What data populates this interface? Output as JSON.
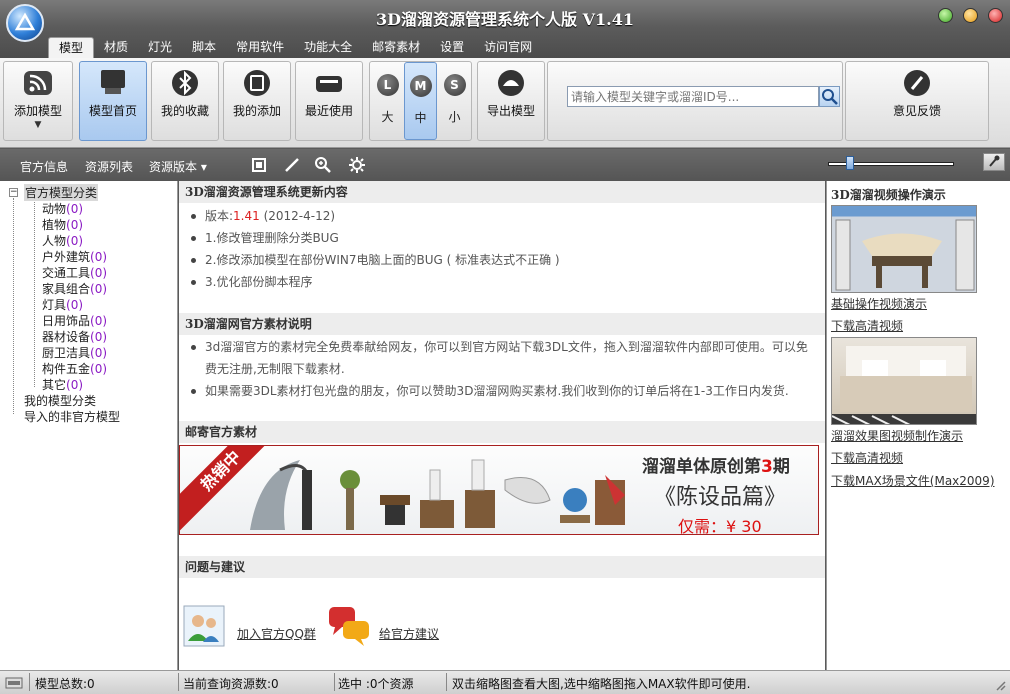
{
  "app": {
    "title": "3D溜溜资源管理系统个人版  V1.41"
  },
  "tabs": [
    "模型",
    "材质",
    "灯光",
    "脚本",
    "常用软件",
    "功能大全",
    "邮寄素材",
    "设置",
    "访问官网"
  ],
  "active_tab": "模型",
  "ribbon": {
    "add_model": "添加模型",
    "model_home": "模型首页",
    "my_favorites": "我的收藏",
    "my_added": "我的添加",
    "recent": "最近使用",
    "size_large": "大",
    "size_medium": "中",
    "size_small": "小",
    "size_large_letter": "L",
    "size_medium_letter": "M",
    "size_small_letter": "S",
    "export_model": "导出模型",
    "search_placeholder": "请输入模型关键字或溜溜ID号...",
    "feedback": "意见反馈"
  },
  "subbar": {
    "official_info": "官方信息",
    "resource_list": "资源列表",
    "resource_version": "资源版本 ▾",
    "slider_level": 0.15
  },
  "tree": {
    "root": "官方模型分类",
    "children": [
      {
        "label": "动物",
        "count": "(0)"
      },
      {
        "label": "植物",
        "count": "(0)"
      },
      {
        "label": "人物",
        "count": "(0)"
      },
      {
        "label": "户外建筑",
        "count": "(0)"
      },
      {
        "label": "交通工具",
        "count": "(0)"
      },
      {
        "label": "家具组合",
        "count": "(0)"
      },
      {
        "label": "灯具",
        "count": "(0)"
      },
      {
        "label": "日用饰品",
        "count": "(0)"
      },
      {
        "label": "器材设备",
        "count": "(0)"
      },
      {
        "label": "厨卫洁具",
        "count": "(0)"
      },
      {
        "label": "构件五金",
        "count": "(0)"
      },
      {
        "label": "其它",
        "count": "(0)"
      }
    ],
    "my_categories": "我的模型分类",
    "imported": "导入的非官方模型"
  },
  "updates": {
    "heading": "3D溜溜资源管理系统更新内容",
    "version_prefix": "版本:",
    "version": "1.41",
    "version_date": " (2012-4-12)",
    "items": [
      "1.修改管理删除分类BUG",
      "2.修改添加模型在部份WIN7电脑上面的BUG ( 标准表达式不正确 )",
      "3.优化部份脚本程序"
    ]
  },
  "official_materials": {
    "heading": "3D溜溜网官方素材说明",
    "item1_line1": "3d溜溜官方的素材完全免费奉献给网友，你可以到官方网站下载3DL文件，拖入到溜溜软件内部即可使用。可以免",
    "item1_line2": "费无注册,无制限下载素材.",
    "item2": "如果需要3DL素材打包光盘的朋友，你可以赞助3D溜溜网购买素材.我们收到你的订单后将在1-3工作日内发货."
  },
  "mail_section": {
    "heading": "邮寄官方素材",
    "banner_badge": "热销中",
    "banner_title_pre": "溜溜单体原创第",
    "banner_title_num": "3",
    "banner_title_post": "期",
    "banner_subtitle": "《陈设品篇》",
    "banner_price": "仅需：¥ 30"
  },
  "qa": {
    "heading": "问题与建议",
    "join_qq": "加入官方QQ群",
    "suggest": "给官方建议"
  },
  "right_panel": {
    "heading": "3D溜溜视频操作演示",
    "link1": "基础操作视频演示",
    "link2": "下载高清视频",
    "link3": "溜溜效果图视频制作演示",
    "link4": "下载高清视频",
    "link5": "下载MAX场景文件(Max2009)"
  },
  "status": {
    "total": "模型总数:0",
    "current_query": "当前查询资源数:0",
    "selected": "选中 :0个资源",
    "hint": "双击缩略图查看大图,选中缩略图拖入MAX软件即可使用."
  },
  "colors": {
    "accent_red": "#c21f1f",
    "count_purple": "#8b1cc4",
    "active_blue": "#a9c9ef"
  }
}
